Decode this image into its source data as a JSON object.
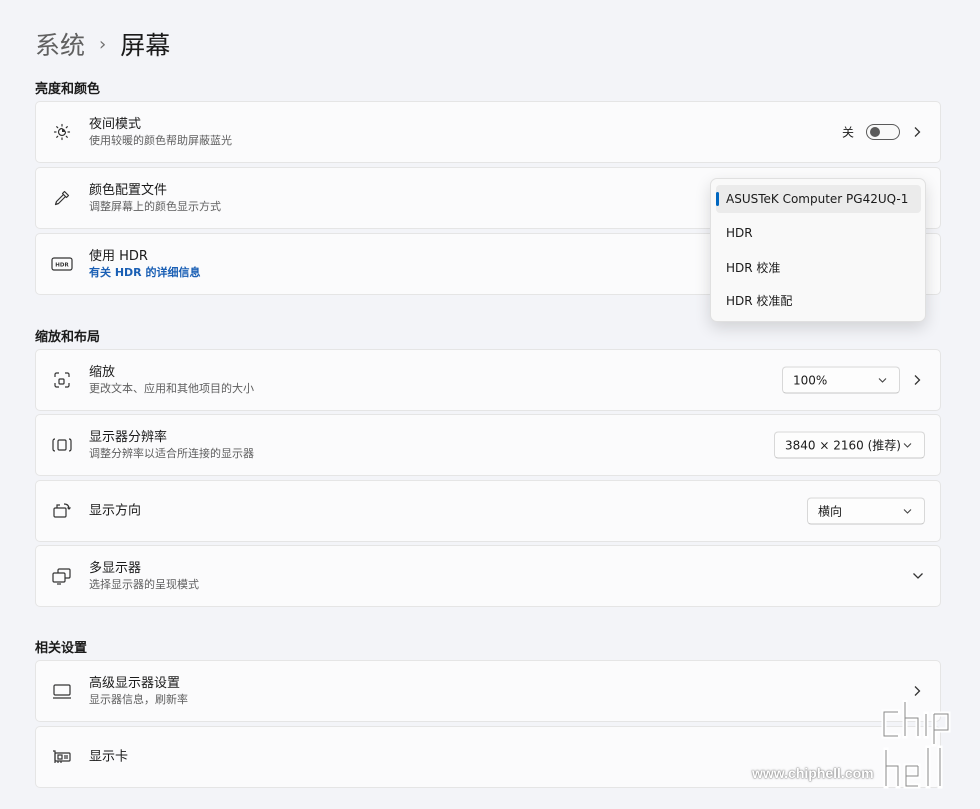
{
  "breadcrumb": {
    "parent": "系统",
    "separator": "›",
    "current": "屏幕"
  },
  "sections": {
    "brightness": "亮度和颜色",
    "scale": "缩放和布局",
    "related": "相关设置"
  },
  "night_light": {
    "title": "夜间模式",
    "desc": "使用较暖的颜色帮助屏蔽蓝光",
    "state_label": "关",
    "on": false
  },
  "color_profile": {
    "title": "颜色配置文件",
    "desc": "调整屏幕上的颜色显示方式"
  },
  "hdr": {
    "title": "使用 HDR",
    "link": "有关 HDR 的详细信息"
  },
  "color_profile_dropdown": {
    "options": [
      "ASUSTeK Computer PG42UQ-1",
      "HDR",
      "HDR 校准",
      "HDR 校准配"
    ],
    "selected": "ASUSTeK Computer PG42UQ-1"
  },
  "scale": {
    "title": "缩放",
    "desc": "更改文本、应用和其他项目的大小",
    "value": "100%"
  },
  "resolution": {
    "title": "显示器分辨率",
    "desc": "调整分辨率以适合所连接的显示器",
    "value": "3840 × 2160 (推荐)"
  },
  "orientation": {
    "title": "显示方向",
    "value": "横向"
  },
  "multi_display": {
    "title": "多显示器",
    "desc": "选择显示器的呈现模式"
  },
  "advanced_display": {
    "title": "高级显示器设置",
    "desc": "显示器信息，刷新率"
  },
  "graphics": {
    "title": "显示卡"
  },
  "watermark": {
    "logo": "chiphell",
    "url": "www.chiphell.com"
  },
  "colors": {
    "accent": "#0067c0",
    "link": "#1a5fb4",
    "background": "#f3f4f8",
    "card": "#fbfbfc"
  }
}
